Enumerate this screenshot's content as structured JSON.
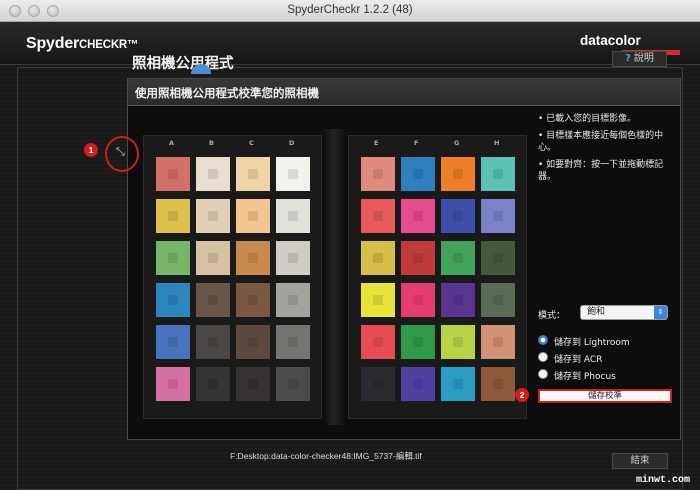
{
  "window": {
    "title": "SpyderCheckr 1.2.2 (48)"
  },
  "brand": {
    "product_main": "Spyder",
    "product_sub": "CHECKR",
    "tm": "™",
    "company": "datacolor"
  },
  "section": {
    "title": "照相機公用程式",
    "help_label": "說明",
    "help_icon": "question-icon"
  },
  "panel": {
    "heading": "使用照相機公用程式校準您的照相機"
  },
  "chart_columns_left": [
    "A",
    "B",
    "C",
    "D"
  ],
  "chart_columns_right": [
    "E",
    "F",
    "G",
    "H"
  ],
  "patches_left": [
    [
      "#d4706a",
      "#e9ddd2",
      "#f0d4a6",
      "#f2f1ec"
    ],
    [
      "#dec04c",
      "#e0cfb5",
      "#f1c690",
      "#e2e0da"
    ],
    [
      "#79b569",
      "#d7c1a3",
      "#c98a4c",
      "#cfcdc6"
    ],
    [
      "#2c86bb",
      "#6a5549",
      "#7b5842",
      "#a4a29d"
    ],
    [
      "#4a73bf",
      "#4a4745",
      "#5c4a40",
      "#767471"
    ],
    [
      "#d86fa3",
      "#363433",
      "#363231",
      "#4d4b4a"
    ]
  ],
  "patches_right": [
    [
      "#e08b7d",
      "#2d7fbf",
      "#ee7f28",
      "#5bc0b5"
    ],
    [
      "#e75c5a",
      "#e64c8e",
      "#3d4fa8",
      "#7a83c9"
    ],
    [
      "#d7bd4a",
      "#c03b3a",
      "#43a35a",
      "#46593b"
    ],
    [
      "#e8e23a",
      "#e73c72",
      "#5a3590",
      "#5a6c55"
    ],
    [
      "#e84d54",
      "#2f9a4a",
      "#b9d347",
      "#d19174"
    ],
    [
      "#2b2c32",
      "#4f3fa2",
      "#2d9cc4",
      "#8f5a3a"
    ]
  ],
  "instructions": [
    "• 已載入您的目標影像。",
    "• 目標樣本應接近每個色樣的中心。",
    "• 如要對齊：按一下並拖動標記器。"
  ],
  "mode": {
    "label": "模式：",
    "value": "飽和"
  },
  "save_options": [
    {
      "label": "儲存到 Lightroom",
      "selected": true
    },
    {
      "label": "儲存到 ACR",
      "selected": false
    },
    {
      "label": "儲存到 Phocus",
      "selected": false
    }
  ],
  "save_button": "儲存校準",
  "file_path": "F:Desktop:data-color-checker48:IMG_5737-編輯.tif",
  "finish_button": "結束",
  "markers": [
    "1",
    "2"
  ],
  "watermark": "minwt.com",
  "colors": {
    "accent_blue": "#3d87e0",
    "highlight_red": "#d21d1d",
    "brand_red": "#d42a2a"
  }
}
